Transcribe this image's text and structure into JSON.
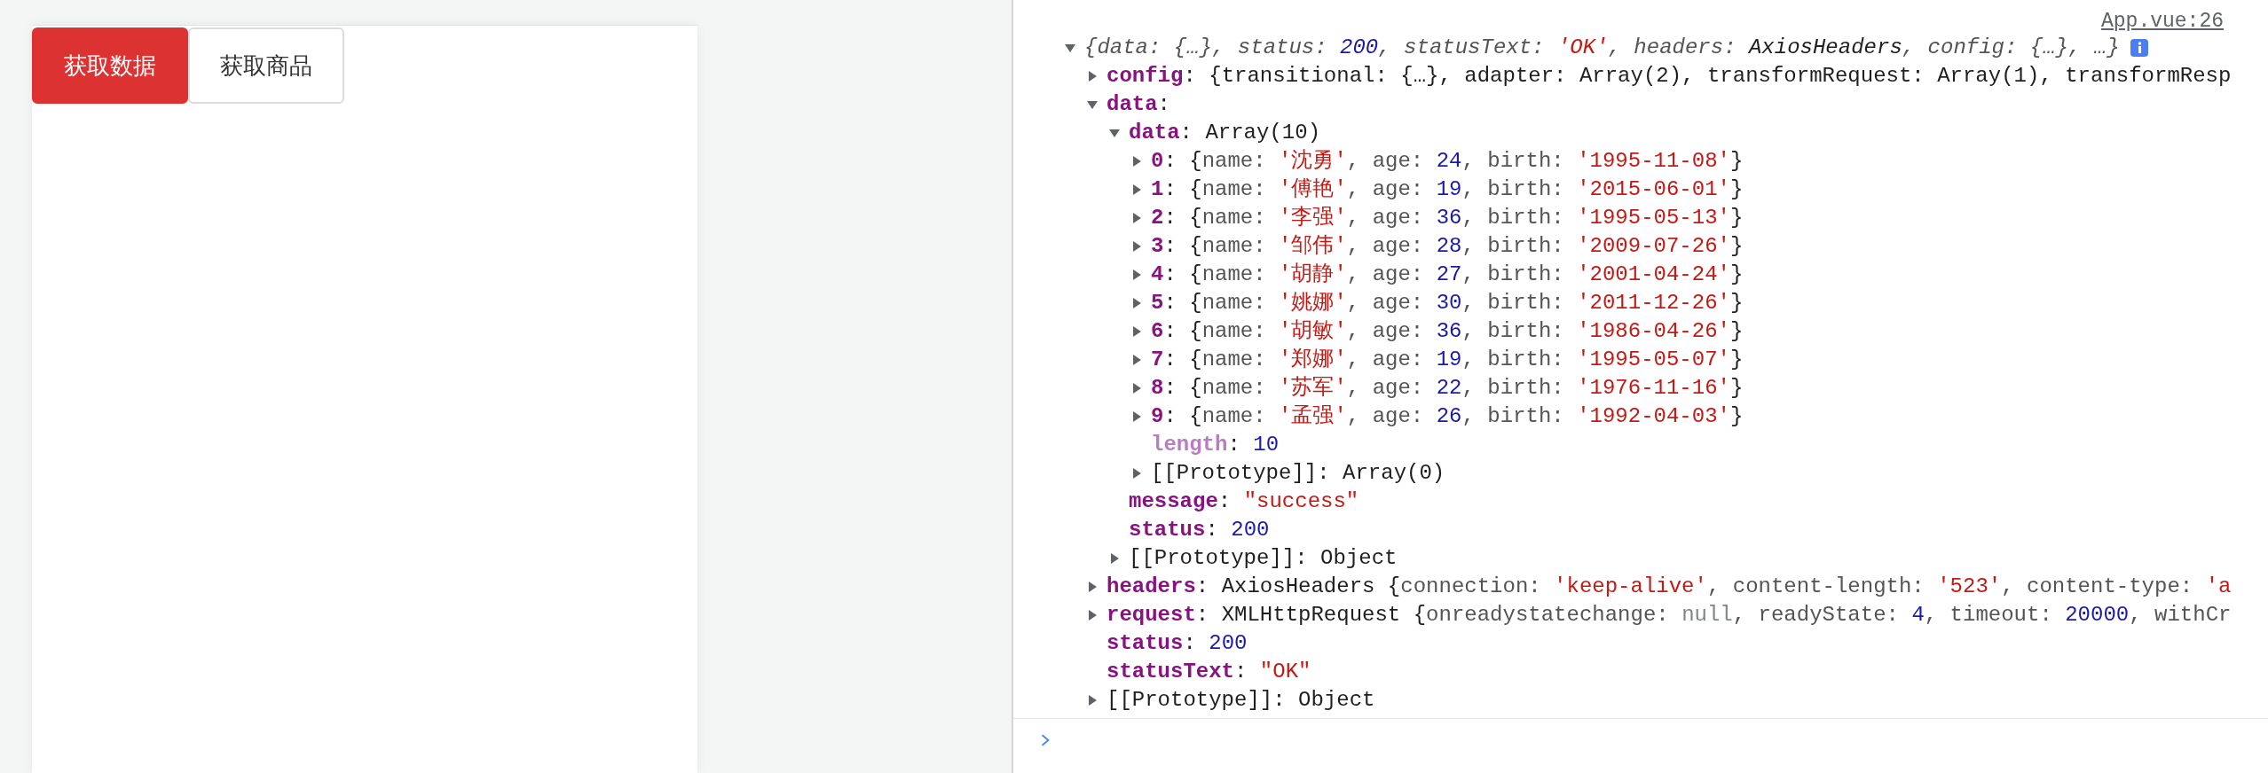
{
  "page": {
    "buttons": [
      {
        "label": "获取数据",
        "kind": "primary"
      },
      {
        "label": "获取商品",
        "kind": "default"
      }
    ]
  },
  "console": {
    "source_link": "App.vue:26",
    "lines": [
      {
        "kind": "summary",
        "expanded": true,
        "tokens": [
          {
            "kind": "punct",
            "text": "{data: {…}, status: "
          },
          {
            "kind": "number",
            "text": "200"
          },
          {
            "kind": "punct",
            "text": ", statusText: "
          },
          {
            "kind": "string",
            "text": "'OK'"
          },
          {
            "kind": "punct",
            "text": ", headers: "
          },
          {
            "kind": "text",
            "text": "AxiosHeaders"
          },
          {
            "kind": "punct",
            "text": ", config: {…}, …}"
          }
        ],
        "children": [
          {
            "kind": "property",
            "expanded": false,
            "tokens": [
              {
                "kind": "key",
                "text": "config"
              },
              {
                "kind": "text",
                "text": ": {transitional: {…}, adapter: Array(2), transformRequest: Array(1), transformResp"
              }
            ]
          },
          {
            "kind": "property",
            "expanded": true,
            "tokens": [
              {
                "kind": "key",
                "text": "data"
              },
              {
                "kind": "text",
                "text": ":"
              }
            ],
            "children": [
              {
                "kind": "property",
                "expanded": true,
                "tokens": [
                  {
                    "kind": "key",
                    "text": "data"
                  },
                  {
                    "kind": "text",
                    "text": ": Array(10)"
                  }
                ],
                "children": [
                  {
                    "kind": "property",
                    "expanded": false,
                    "tokens": [
                      {
                        "kind": "key",
                        "text": "0"
                      },
                      {
                        "kind": "text",
                        "text": ": {"
                      },
                      {
                        "kind": "punct",
                        "text": "name: "
                      },
                      {
                        "kind": "string",
                        "text": "'沈勇'"
                      },
                      {
                        "kind": "punct",
                        "text": ", age: "
                      },
                      {
                        "kind": "number",
                        "text": "24"
                      },
                      {
                        "kind": "punct",
                        "text": ", birth: "
                      },
                      {
                        "kind": "string",
                        "text": "'1995-11-08'"
                      },
                      {
                        "kind": "text",
                        "text": "}"
                      }
                    ]
                  },
                  {
                    "kind": "property",
                    "expanded": false,
                    "tokens": [
                      {
                        "kind": "key",
                        "text": "1"
                      },
                      {
                        "kind": "text",
                        "text": ": {"
                      },
                      {
                        "kind": "punct",
                        "text": "name: "
                      },
                      {
                        "kind": "string",
                        "text": "'傅艳'"
                      },
                      {
                        "kind": "punct",
                        "text": ", age: "
                      },
                      {
                        "kind": "number",
                        "text": "19"
                      },
                      {
                        "kind": "punct",
                        "text": ", birth: "
                      },
                      {
                        "kind": "string",
                        "text": "'2015-06-01'"
                      },
                      {
                        "kind": "text",
                        "text": "}"
                      }
                    ]
                  },
                  {
                    "kind": "property",
                    "expanded": false,
                    "tokens": [
                      {
                        "kind": "key",
                        "text": "2"
                      },
                      {
                        "kind": "text",
                        "text": ": {"
                      },
                      {
                        "kind": "punct",
                        "text": "name: "
                      },
                      {
                        "kind": "string",
                        "text": "'李强'"
                      },
                      {
                        "kind": "punct",
                        "text": ", age: "
                      },
                      {
                        "kind": "number",
                        "text": "36"
                      },
                      {
                        "kind": "punct",
                        "text": ", birth: "
                      },
                      {
                        "kind": "string",
                        "text": "'1995-05-13'"
                      },
                      {
                        "kind": "text",
                        "text": "}"
                      }
                    ]
                  },
                  {
                    "kind": "property",
                    "expanded": false,
                    "tokens": [
                      {
                        "kind": "key",
                        "text": "3"
                      },
                      {
                        "kind": "text",
                        "text": ": {"
                      },
                      {
                        "kind": "punct",
                        "text": "name: "
                      },
                      {
                        "kind": "string",
                        "text": "'邹伟'"
                      },
                      {
                        "kind": "punct",
                        "text": ", age: "
                      },
                      {
                        "kind": "number",
                        "text": "28"
                      },
                      {
                        "kind": "punct",
                        "text": ", birth: "
                      },
                      {
                        "kind": "string",
                        "text": "'2009-07-26'"
                      },
                      {
                        "kind": "text",
                        "text": "}"
                      }
                    ]
                  },
                  {
                    "kind": "property",
                    "expanded": false,
                    "tokens": [
                      {
                        "kind": "key",
                        "text": "4"
                      },
                      {
                        "kind": "text",
                        "text": ": {"
                      },
                      {
                        "kind": "punct",
                        "text": "name: "
                      },
                      {
                        "kind": "string",
                        "text": "'胡静'"
                      },
                      {
                        "kind": "punct",
                        "text": ", age: "
                      },
                      {
                        "kind": "number",
                        "text": "27"
                      },
                      {
                        "kind": "punct",
                        "text": ", birth: "
                      },
                      {
                        "kind": "string",
                        "text": "'2001-04-24'"
                      },
                      {
                        "kind": "text",
                        "text": "}"
                      }
                    ]
                  },
                  {
                    "kind": "property",
                    "expanded": false,
                    "tokens": [
                      {
                        "kind": "key",
                        "text": "5"
                      },
                      {
                        "kind": "text",
                        "text": ": {"
                      },
                      {
                        "kind": "punct",
                        "text": "name: "
                      },
                      {
                        "kind": "string",
                        "text": "'姚娜'"
                      },
                      {
                        "kind": "punct",
                        "text": ", age: "
                      },
                      {
                        "kind": "number",
                        "text": "30"
                      },
                      {
                        "kind": "punct",
                        "text": ", birth: "
                      },
                      {
                        "kind": "string",
                        "text": "'2011-12-26'"
                      },
                      {
                        "kind": "text",
                        "text": "}"
                      }
                    ]
                  },
                  {
                    "kind": "property",
                    "expanded": false,
                    "tokens": [
                      {
                        "kind": "key",
                        "text": "6"
                      },
                      {
                        "kind": "text",
                        "text": ": {"
                      },
                      {
                        "kind": "punct",
                        "text": "name: "
                      },
                      {
                        "kind": "string",
                        "text": "'胡敏'"
                      },
                      {
                        "kind": "punct",
                        "text": ", age: "
                      },
                      {
                        "kind": "number",
                        "text": "36"
                      },
                      {
                        "kind": "punct",
                        "text": ", birth: "
                      },
                      {
                        "kind": "string",
                        "text": "'1986-04-26'"
                      },
                      {
                        "kind": "text",
                        "text": "}"
                      }
                    ]
                  },
                  {
                    "kind": "property",
                    "expanded": false,
                    "tokens": [
                      {
                        "kind": "key",
                        "text": "7"
                      },
                      {
                        "kind": "text",
                        "text": ": {"
                      },
                      {
                        "kind": "punct",
                        "text": "name: "
                      },
                      {
                        "kind": "string",
                        "text": "'郑娜'"
                      },
                      {
                        "kind": "punct",
                        "text": ", age: "
                      },
                      {
                        "kind": "number",
                        "text": "19"
                      },
                      {
                        "kind": "punct",
                        "text": ", birth: "
                      },
                      {
                        "kind": "string",
                        "text": "'1995-05-07'"
                      },
                      {
                        "kind": "text",
                        "text": "}"
                      }
                    ]
                  },
                  {
                    "kind": "property",
                    "expanded": false,
                    "tokens": [
                      {
                        "kind": "key",
                        "text": "8"
                      },
                      {
                        "kind": "text",
                        "text": ": {"
                      },
                      {
                        "kind": "punct",
                        "text": "name: "
                      },
                      {
                        "kind": "string",
                        "text": "'苏军'"
                      },
                      {
                        "kind": "punct",
                        "text": ", age: "
                      },
                      {
                        "kind": "number",
                        "text": "22"
                      },
                      {
                        "kind": "punct",
                        "text": ", birth: "
                      },
                      {
                        "kind": "string",
                        "text": "'1976-11-16'"
                      },
                      {
                        "kind": "text",
                        "text": "}"
                      }
                    ]
                  },
                  {
                    "kind": "property",
                    "expanded": false,
                    "tokens": [
                      {
                        "kind": "key",
                        "text": "9"
                      },
                      {
                        "kind": "text",
                        "text": ": {"
                      },
                      {
                        "kind": "punct",
                        "text": "name: "
                      },
                      {
                        "kind": "string",
                        "text": "'孟强'"
                      },
                      {
                        "kind": "punct",
                        "text": ", age: "
                      },
                      {
                        "kind": "number",
                        "text": "26"
                      },
                      {
                        "kind": "punct",
                        "text": ", birth: "
                      },
                      {
                        "kind": "string",
                        "text": "'1992-04-03'"
                      },
                      {
                        "kind": "text",
                        "text": "}"
                      }
                    ]
                  },
                  {
                    "kind": "property",
                    "tokens": [
                      {
                        "kind": "key-dim",
                        "text": "length"
                      },
                      {
                        "kind": "text",
                        "text": ": "
                      },
                      {
                        "kind": "number",
                        "text": "10"
                      }
                    ]
                  },
                  {
                    "kind": "property",
                    "expanded": false,
                    "tokens": [
                      {
                        "kind": "text",
                        "text": "[[Prototype]]: Array(0)"
                      }
                    ]
                  }
                ]
              },
              {
                "kind": "property",
                "tokens": [
                  {
                    "kind": "key",
                    "text": "message"
                  },
                  {
                    "kind": "text",
                    "text": ": "
                  },
                  {
                    "kind": "string",
                    "text": "\"success\""
                  }
                ]
              },
              {
                "kind": "property",
                "tokens": [
                  {
                    "kind": "key",
                    "text": "status"
                  },
                  {
                    "kind": "text",
                    "text": ": "
                  },
                  {
                    "kind": "number",
                    "text": "200"
                  }
                ]
              },
              {
                "kind": "property",
                "expanded": false,
                "tokens": [
                  {
                    "kind": "text",
                    "text": "[[Prototype]]: Object"
                  }
                ]
              }
            ]
          },
          {
            "kind": "property",
            "expanded": false,
            "tokens": [
              {
                "kind": "key",
                "text": "headers"
              },
              {
                "kind": "text",
                "text": ": AxiosHeaders {"
              },
              {
                "kind": "punct",
                "text": "connection: "
              },
              {
                "kind": "string",
                "text": "'keep-alive'"
              },
              {
                "kind": "punct",
                "text": ", content-length: "
              },
              {
                "kind": "string",
                "text": "'523'"
              },
              {
                "kind": "punct",
                "text": ", content-type: "
              },
              {
                "kind": "string",
                "text": "'a"
              }
            ]
          },
          {
            "kind": "property",
            "expanded": false,
            "tokens": [
              {
                "kind": "key",
                "text": "request"
              },
              {
                "kind": "text",
                "text": ": XMLHttpRequest {"
              },
              {
                "kind": "punct",
                "text": "onreadystatechange: "
              },
              {
                "kind": "null",
                "text": "null"
              },
              {
                "kind": "punct",
                "text": ", readyState: "
              },
              {
                "kind": "number",
                "text": "4"
              },
              {
                "kind": "punct",
                "text": ", timeout: "
              },
              {
                "kind": "number",
                "text": "20000"
              },
              {
                "kind": "punct",
                "text": ", withCr"
              }
            ]
          },
          {
            "kind": "property",
            "tokens": [
              {
                "kind": "key",
                "text": "status"
              },
              {
                "kind": "text",
                "text": ": "
              },
              {
                "kind": "number",
                "text": "200"
              }
            ]
          },
          {
            "kind": "property",
            "tokens": [
              {
                "kind": "key",
                "text": "statusText"
              },
              {
                "kind": "text",
                "text": ": "
              },
              {
                "kind": "string",
                "text": "\"OK\""
              }
            ]
          },
          {
            "kind": "property",
            "expanded": false,
            "tokens": [
              {
                "kind": "text",
                "text": "[[Prototype]]: Object"
              }
            ]
          }
        ]
      }
    ]
  }
}
